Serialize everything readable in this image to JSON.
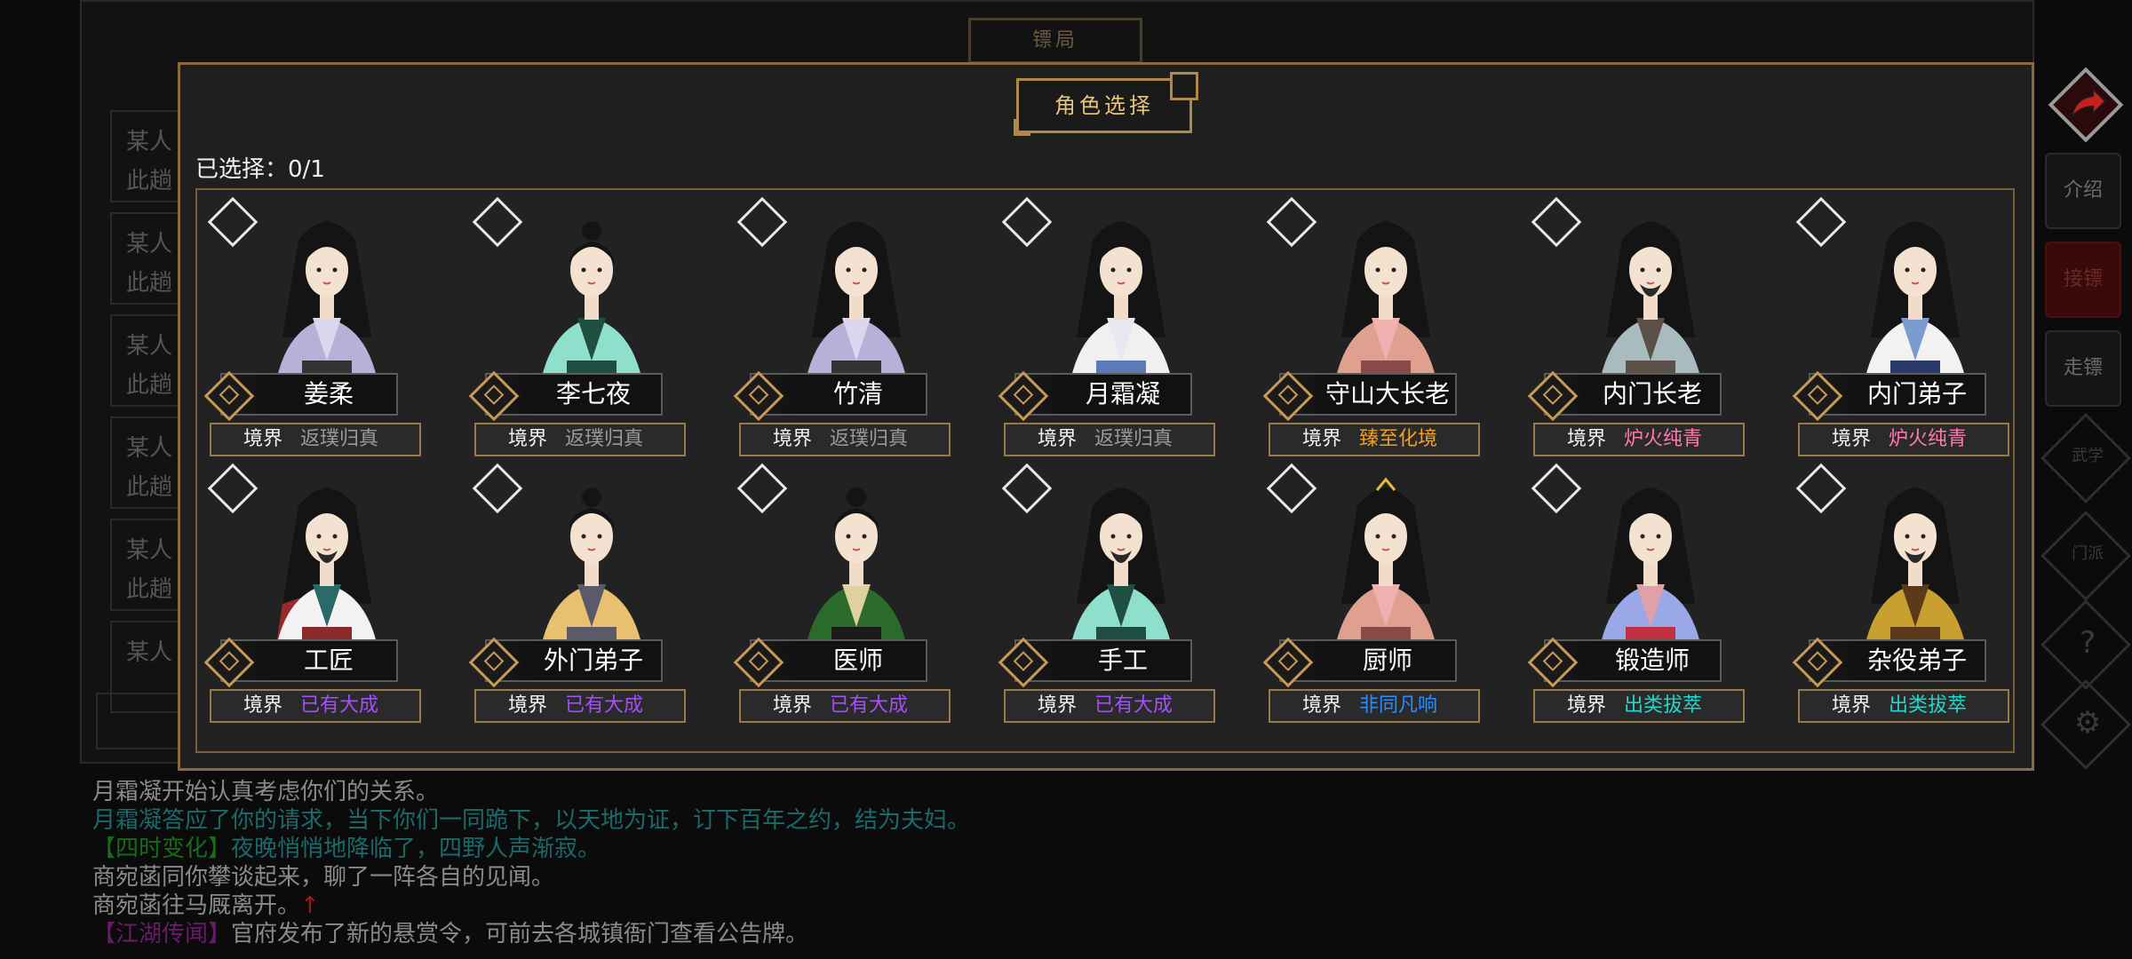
{
  "background": {
    "title": "镖局",
    "list_items": [
      {
        "line1": "某人",
        "line2": "此趟"
      },
      {
        "line1": "某人",
        "line2": "此趟"
      },
      {
        "line1": "某人",
        "line2": "此趟"
      },
      {
        "line1": "某人",
        "line2": "此趟"
      },
      {
        "line1": "某人",
        "line2": "此趟"
      },
      {
        "line1": "某人",
        "line2": ""
      }
    ]
  },
  "side_buttons": {
    "intro": "介绍",
    "accept": "接镖",
    "escort": "走镖",
    "martial": "武学",
    "sect": "门派",
    "help": "?"
  },
  "modal": {
    "title": "角色选择",
    "selected_label": "已选择：0/1"
  },
  "realm_label": "境界",
  "characters": [
    {
      "name": "姜柔",
      "realm": "返璞归真",
      "realm_color": "#9a9a9a",
      "style": "female-purple",
      "selected": false
    },
    {
      "name": "李七夜",
      "realm": "返璞归真",
      "realm_color": "#9a9a9a",
      "style": "male-teal",
      "selected": false
    },
    {
      "name": "竹清",
      "realm": "返璞归真",
      "realm_color": "#9a9a9a",
      "style": "female-purple-long",
      "selected": false
    },
    {
      "name": "月霜凝",
      "realm": "返璞归真",
      "realm_color": "#9a9a9a",
      "style": "female-white",
      "selected": false
    },
    {
      "name": "守山大长老",
      "realm": "臻至化境",
      "realm_color": "#f0a020",
      "style": "female-pink",
      "selected": false
    },
    {
      "name": "内门长老",
      "realm": "炉火纯青",
      "realm_color": "#ff7ab0",
      "style": "male-grey-beard",
      "selected": false
    },
    {
      "name": "内门弟子",
      "realm": "炉火纯青",
      "realm_color": "#ff7ab0",
      "style": "female-white-blue",
      "selected": false
    },
    {
      "name": "工匠",
      "realm": "已有大成",
      "realm_color": "#a64dff",
      "style": "male-red-white",
      "selected": false
    },
    {
      "name": "外门弟子",
      "realm": "已有大成",
      "realm_color": "#a64dff",
      "style": "female-yellow",
      "selected": false
    },
    {
      "name": "医师",
      "realm": "已有大成",
      "realm_color": "#a64dff",
      "style": "female-green",
      "selected": false
    },
    {
      "name": "手工",
      "realm": "已有大成",
      "realm_color": "#a64dff",
      "style": "male-teal-beard",
      "selected": false
    },
    {
      "name": "厨师",
      "realm": "非同凡响",
      "realm_color": "#2a8cff",
      "style": "female-pink-crown",
      "selected": false
    },
    {
      "name": "锻造师",
      "realm": "出类拔萃",
      "realm_color": "#20d8d0",
      "style": "female-blue-red",
      "selected": false
    },
    {
      "name": "杂役弟子",
      "realm": "出类拔萃",
      "realm_color": "#20d8d0",
      "style": "male-gold",
      "selected": false
    }
  ],
  "log": [
    {
      "segments": [
        {
          "text": "月霜凝开始认真考虑你们的关系。",
          "color": "#8a8a8a"
        }
      ]
    },
    {
      "segments": [
        {
          "text": "月霜凝答应了你的请求，当下你们一同跪下，以天地为证，订下百年之约，结为夫妇。",
          "color": "#1a6a6a"
        }
      ]
    },
    {
      "segments": [
        {
          "text": "【四时变化】",
          "color": "#1a6a1a"
        },
        {
          "text": "夜晚悄悄地降临了，四野人声渐寂。",
          "color": "#1a6a6a"
        }
      ]
    },
    {
      "segments": [
        {
          "text": "商宛菡同你攀谈起来，聊了一阵各自的见闻。",
          "color": "#8a8a8a"
        }
      ]
    },
    {
      "segments": [
        {
          "text": "商宛菡往马厩离开。",
          "color": "#8a8a8a"
        },
        {
          "text": "↑",
          "color": "#a01818"
        }
      ]
    },
    {
      "segments": [
        {
          "text": "【江湖传闻】",
          "color": "#6a1a6a"
        },
        {
          "text": "官府发布了新的悬赏令，可前去各城镇衙门查看公告牌。",
          "color": "#8a8a8a"
        }
      ]
    }
  ]
}
